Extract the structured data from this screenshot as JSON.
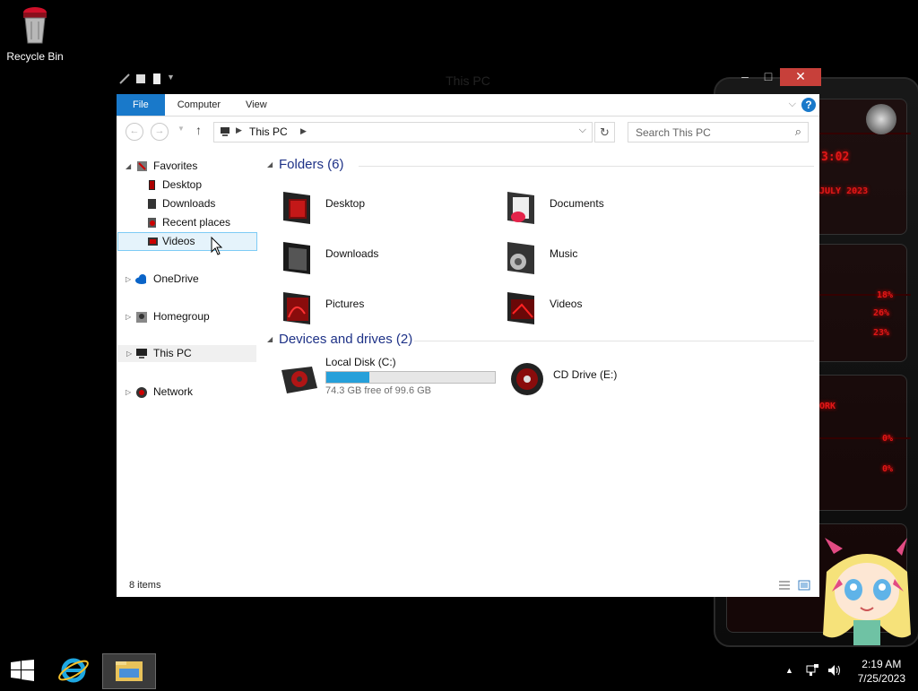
{
  "desktop": {
    "recycle_bin_label": "Recycle Bin"
  },
  "window": {
    "title": "This PC",
    "ribbon_tabs": [
      "File",
      "Computer",
      "View"
    ],
    "help_glyph": "?",
    "address": {
      "crumb": "This PC"
    },
    "search_placeholder": "Search This PC"
  },
  "nav": {
    "favorites": "Favorites",
    "favorite_items": [
      "Desktop",
      "Downloads",
      "Recent places",
      "Videos"
    ],
    "onedrive": "OneDrive",
    "homegroup": "Homegroup",
    "this_pc": "This PC",
    "network": "Network"
  },
  "content": {
    "folders_header": "Folders (6)",
    "folders": [
      "Desktop",
      "Documents",
      "Downloads",
      "Music",
      "Pictures",
      "Videos"
    ],
    "devices_header": "Devices and drives (2)",
    "local_disk": {
      "name": "Local Disk (C:)",
      "free_text": "74.3 GB free of 99.6 GB",
      "used_fraction": 0.254
    },
    "cd_drive": {
      "name": "CD Drive (E:)"
    }
  },
  "status": {
    "count": "8 items"
  },
  "taskbar": {
    "time": "2:19 AM",
    "date": "7/25/2023"
  },
  "colors": {
    "accent": "#1979ca",
    "close": "#c7403a",
    "bar_fill": "#26a0da",
    "gadget_red": "#e01818"
  }
}
